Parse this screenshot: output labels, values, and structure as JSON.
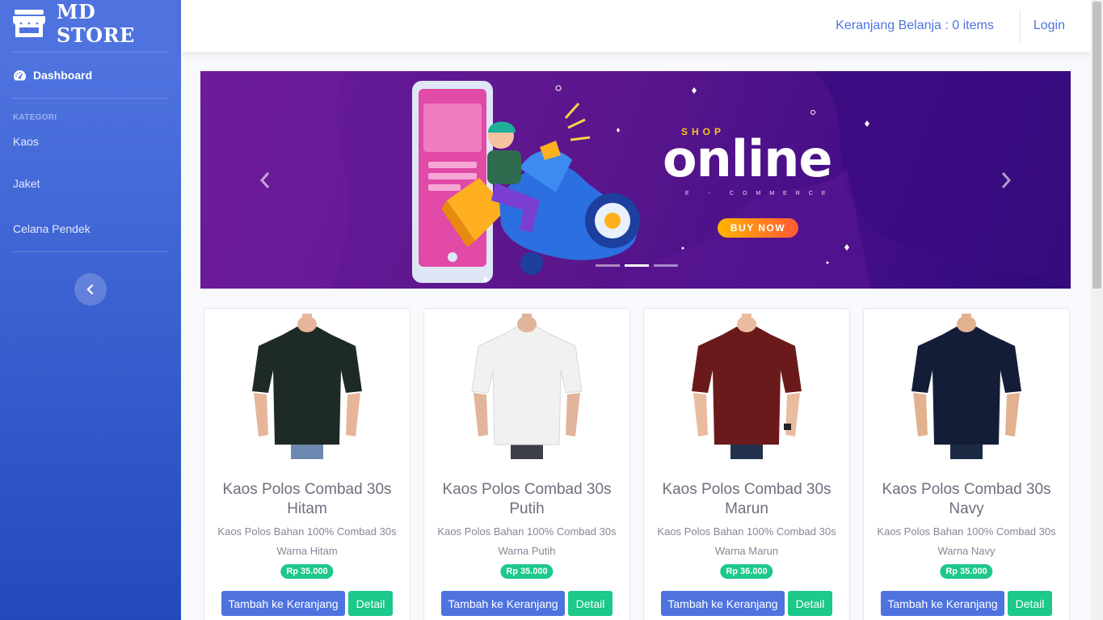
{
  "brand": {
    "name": "MD STORE",
    "icon": "store-icon"
  },
  "sidebar": {
    "dashboard_label": "Dashboard",
    "heading": "KATEGORI",
    "categories": [
      {
        "label": "Kaos"
      },
      {
        "label": "Jaket"
      },
      {
        "label": "Celana Pendek"
      }
    ],
    "toggle_icon": "chevron-left-icon"
  },
  "topbar": {
    "cart_label": "Keranjang Belanja : 0 items",
    "login_label": "Login"
  },
  "carousel": {
    "slide_count": 3,
    "active_index": 1,
    "banner": {
      "small_text": "SHOP",
      "big_text": "online",
      "subtitle": "E - COMMERCE",
      "cta": "BUY NOW"
    }
  },
  "products": [
    {
      "title": "Kaos Polos Combad 30s Hitam",
      "desc": "Kaos Polos Bahan 100% Combad 30s Warna Hitam",
      "price": "Rp 35.000",
      "shirt_color": "#1e2a26",
      "add_label": "Tambah ke Keranjang",
      "detail_label": "Detail"
    },
    {
      "title": "Kaos Polos Combad 30s Putih",
      "desc": "Kaos Polos Bahan 100% Combad 30s Warna Putih",
      "price": "Rp 35.000",
      "shirt_color": "#f1f1f1",
      "add_label": "Tambah ke Keranjang",
      "detail_label": "Detail"
    },
    {
      "title": "Kaos Polos Combad 30s Marun",
      "desc": "Kaos Polos Bahan 100% Combad 30s Warna Marun",
      "price": "Rp 36.000",
      "shirt_color": "#6b1a1c",
      "add_label": "Tambah ke Keranjang",
      "detail_label": "Detail"
    },
    {
      "title": "Kaos Polos Combad 30s Navy",
      "desc": "Kaos Polos Bahan 100% Combad 30s Warna Navy",
      "price": "Rp 35.000",
      "shirt_color": "#141d38",
      "add_label": "Tambah ke Keranjang",
      "detail_label": "Detail"
    }
  ],
  "colors": {
    "primary": "#4e73df",
    "success": "#1cc88a",
    "text_muted": "#858796"
  }
}
